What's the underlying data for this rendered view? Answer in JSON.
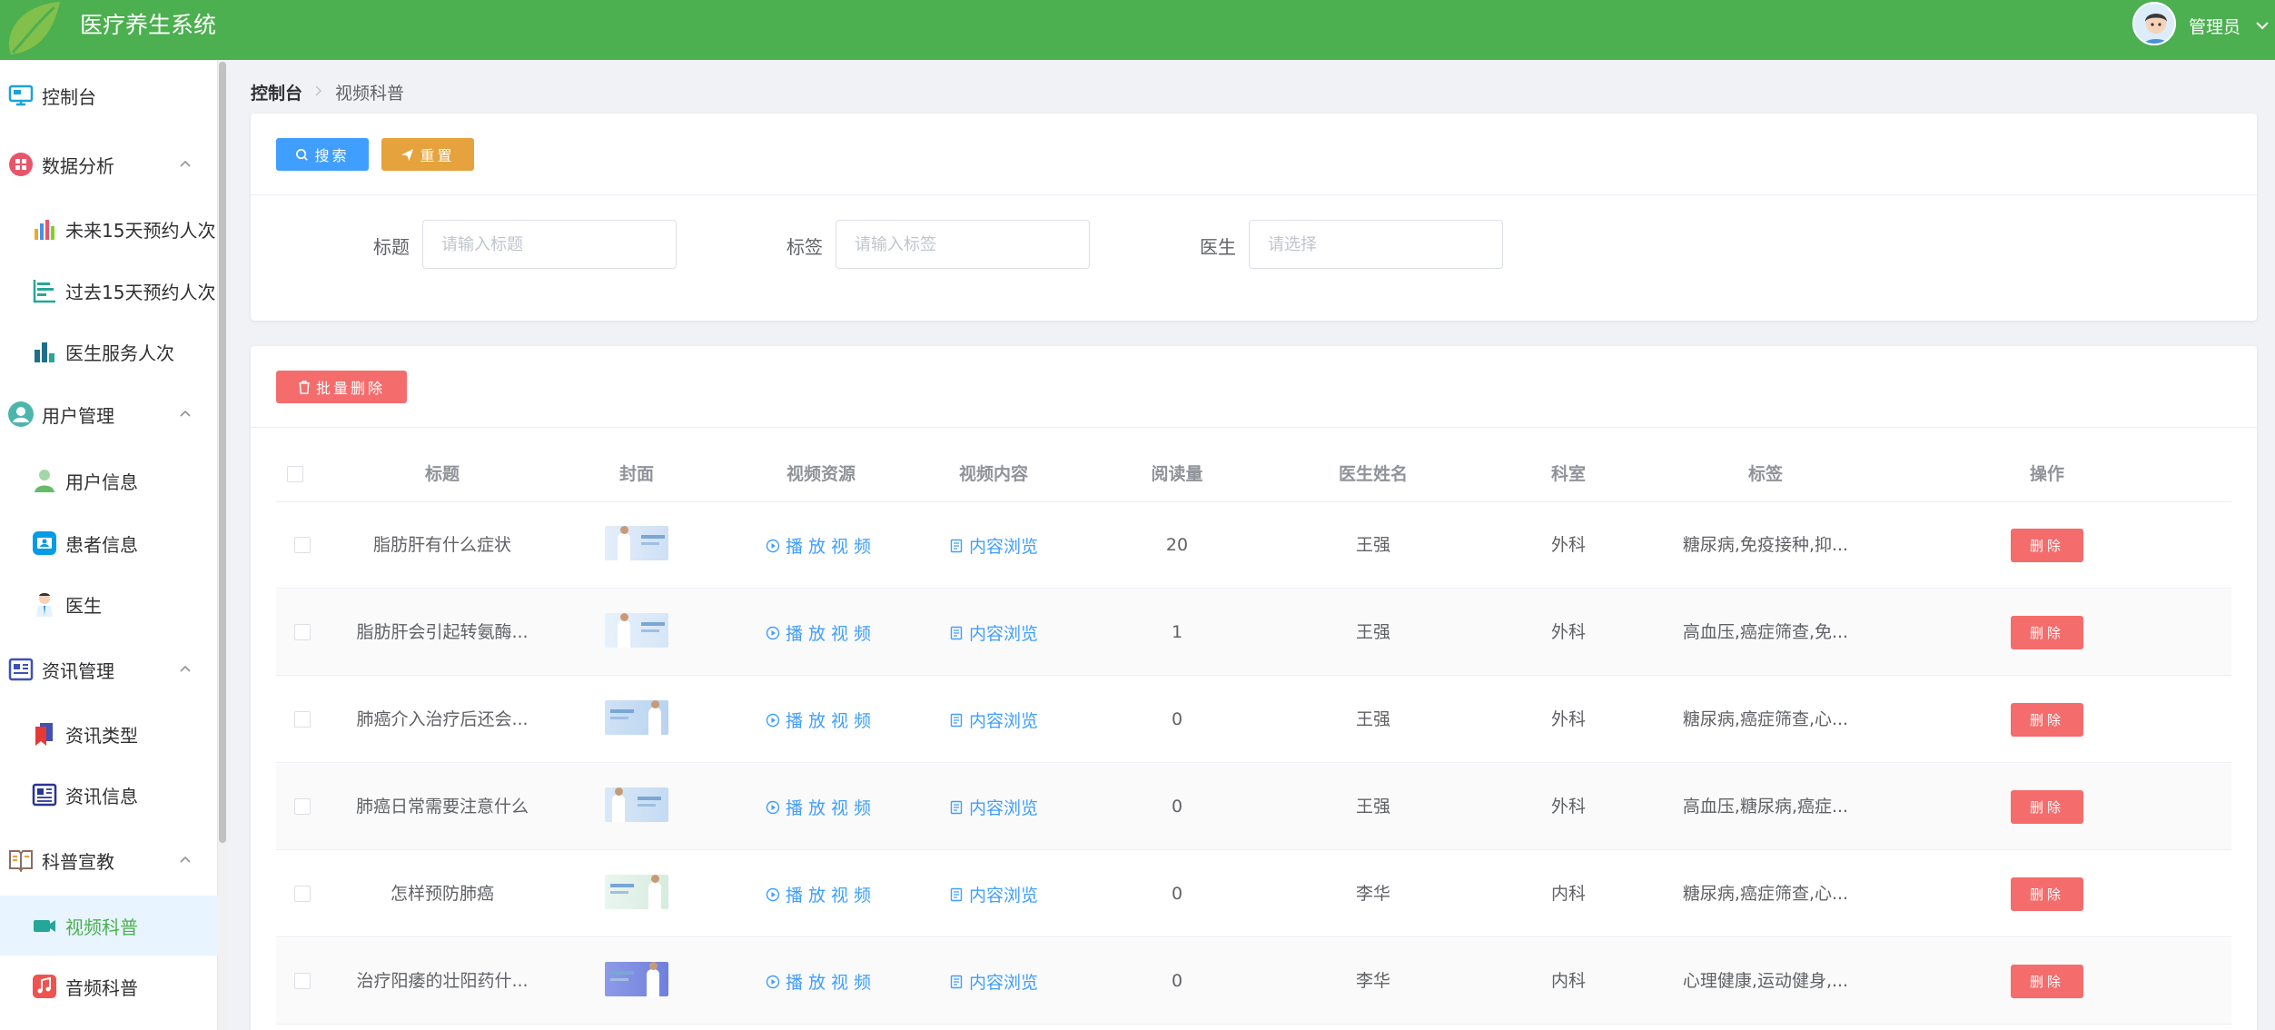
{
  "header": {
    "app_title": "医疗养生系统",
    "user_name": "管理员",
    "brand_color": "#4caf50"
  },
  "sidebar": {
    "items": [
      {
        "label": "控制台",
        "icon": "monitor-icon",
        "level": 1
      },
      {
        "label": "数据分析",
        "icon": "grid-icon",
        "level": 1,
        "expanded": true
      },
      {
        "label": "未来15天预约人次",
        "icon": "bar-chart-icon",
        "level": 2
      },
      {
        "label": "过去15天预约人次",
        "icon": "list-chart-icon",
        "level": 2
      },
      {
        "label": "医生服务人次",
        "icon": "column-chart-icon",
        "level": 2
      },
      {
        "label": "用户管理",
        "icon": "user-circle-icon",
        "level": 1,
        "expanded": true
      },
      {
        "label": "用户信息",
        "icon": "user-icon",
        "level": 2
      },
      {
        "label": "患者信息",
        "icon": "id-card-icon",
        "level": 2
      },
      {
        "label": "医生",
        "icon": "doctor-icon",
        "level": 2
      },
      {
        "label": "资讯管理",
        "icon": "news-icon",
        "level": 1,
        "expanded": true
      },
      {
        "label": "资讯类型",
        "icon": "bookmark-icon",
        "level": 2
      },
      {
        "label": "资讯信息",
        "icon": "newspaper-icon",
        "level": 2
      },
      {
        "label": "科普宣教",
        "icon": "book-icon",
        "level": 1,
        "expanded": true
      },
      {
        "label": "视频科普",
        "icon": "video-icon",
        "level": 2,
        "active": true
      },
      {
        "label": "音频科普",
        "icon": "music-icon",
        "level": 2
      }
    ]
  },
  "breadcrumb": {
    "home": "控制台",
    "current": "视频科普"
  },
  "search": {
    "search_button": "搜索",
    "reset_button": "重置",
    "title_label": "标题",
    "title_placeholder": "请输入标题",
    "tag_label": "标签",
    "tag_placeholder": "请输入标签",
    "doctor_label": "医生",
    "doctor_placeholder": "请选择"
  },
  "table": {
    "batch_delete_label": "批量删除",
    "columns": [
      "标题",
      "封面",
      "视频资源",
      "视频内容",
      "阅读量",
      "医生姓名",
      "科室",
      "标签",
      "操作"
    ],
    "play_label": "播放视频",
    "browse_label": "内容浏览",
    "delete_label": "删除",
    "rows": [
      {
        "title": "脂肪肝有什么症状",
        "views": "20",
        "doctor": "王强",
        "department": "外科",
        "tags": "糖尿病,免疫接种,抑..."
      },
      {
        "title": "脂肪肝会引起转氨酶...",
        "views": "1",
        "doctor": "王强",
        "department": "外科",
        "tags": "高血压,癌症筛查,免..."
      },
      {
        "title": "肺癌介入治疗后还会...",
        "views": "0",
        "doctor": "王强",
        "department": "外科",
        "tags": "糖尿病,癌症筛查,心..."
      },
      {
        "title": "肺癌日常需要注意什么",
        "views": "0",
        "doctor": "王强",
        "department": "外科",
        "tags": "高血压,糖尿病,癌症..."
      },
      {
        "title": "怎样预防肺癌",
        "views": "0",
        "doctor": "李华",
        "department": "内科",
        "tags": "糖尿病,癌症筛查,心..."
      },
      {
        "title": "治疗阳痿的壮阳药什...",
        "views": "0",
        "doctor": "李华",
        "department": "内科",
        "tags": "心理健康,运动健身,..."
      }
    ]
  }
}
